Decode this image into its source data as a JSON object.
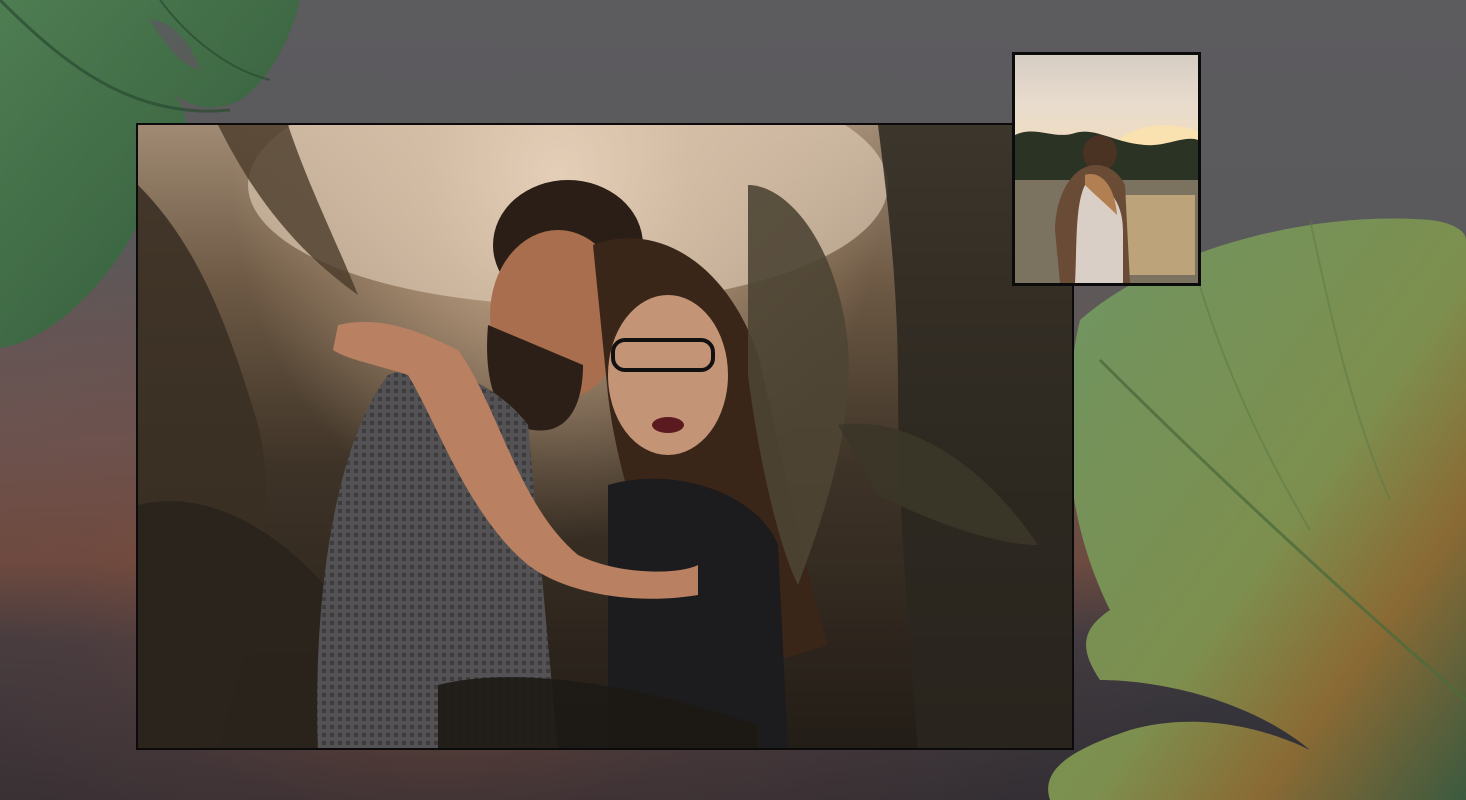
{
  "scene": {
    "background_icon": "monstera-leaf-icon",
    "main_photo_subject": "couple-portrait",
    "thumbnail_subject": "couple-at-lake-sunset"
  },
  "colors": {
    "frame_border": "#0b0b0b",
    "leaf_green": "#3f6b46",
    "leaf_light": "#5f8a58",
    "sky_warm": "#f1dcc0"
  }
}
